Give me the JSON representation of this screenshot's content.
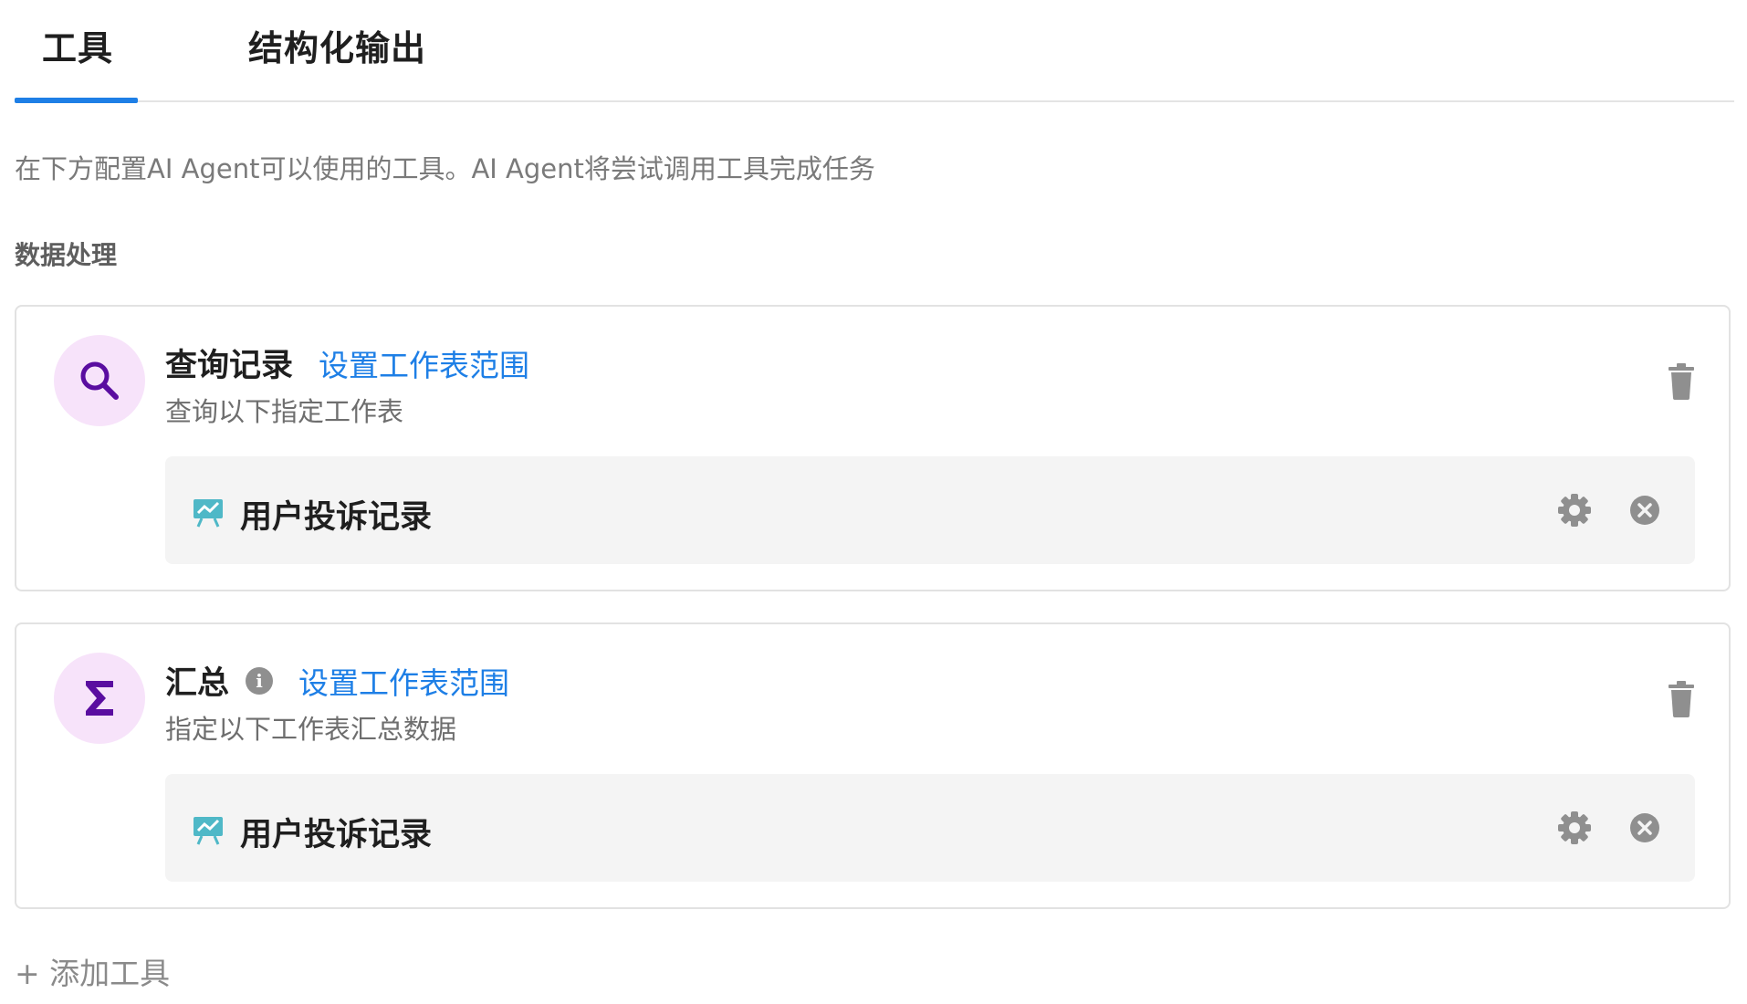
{
  "tabs": [
    {
      "label": "工具",
      "active": true
    },
    {
      "label": "结构化输出",
      "active": false
    }
  ],
  "description": "在下方配置AI Agent可以使用的工具。AI Agent将尝试调用工具完成任务",
  "section_title": "数据处理",
  "tools": [
    {
      "name": "查询记录",
      "icon": "search-icon",
      "has_info": false,
      "scope_link": "设置工作表范围",
      "subtitle": "查询以下指定工作表",
      "sheet": {
        "name": "用户投诉记录",
        "icon": "chart-board-icon"
      }
    },
    {
      "name": "汇总",
      "icon": "sigma-icon",
      "has_info": true,
      "scope_link": "设置工作表范围",
      "subtitle": "指定以下工作表汇总数据",
      "sheet": {
        "name": "用户投诉记录",
        "icon": "chart-board-icon"
      }
    }
  ],
  "add_tool_label": "+ 添加工具",
  "colors": {
    "accent": "#1e7fe6",
    "avatar_bg": "#f7e3fa",
    "avatar_icon": "#5a0da0",
    "sheet_icon": "#4fb8c7",
    "muted_icon": "#8f8f8f"
  }
}
